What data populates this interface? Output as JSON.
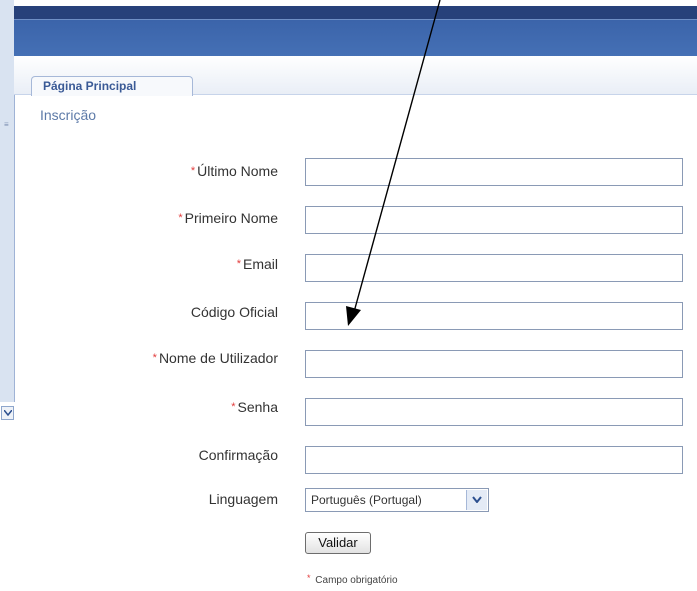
{
  "tabs": {
    "home": "Página Principal"
  },
  "section": {
    "title": "Inscrição"
  },
  "form": {
    "fields": [
      {
        "label": "Último Nome",
        "required": true,
        "value": ""
      },
      {
        "label": "Primeiro Nome",
        "required": true,
        "value": ""
      },
      {
        "label": "Email",
        "required": true,
        "value": ""
      },
      {
        "label": "Código Oficial",
        "required": false,
        "value": ""
      },
      {
        "label": "Nome de Utilizador",
        "required": true,
        "value": ""
      },
      {
        "label": "Senha",
        "required": true,
        "value": ""
      },
      {
        "label": "Confirmação",
        "required": false,
        "value": ""
      }
    ],
    "language_label": "Linguagem",
    "language_value": "Português (Portugal)",
    "submit_label": "Validar",
    "required_marker": "*",
    "required_note": "Campo obrigatório"
  },
  "colors": {
    "header_dark": "#27417a",
    "header_blue": "#4570b5",
    "required": "#e23b3b"
  }
}
